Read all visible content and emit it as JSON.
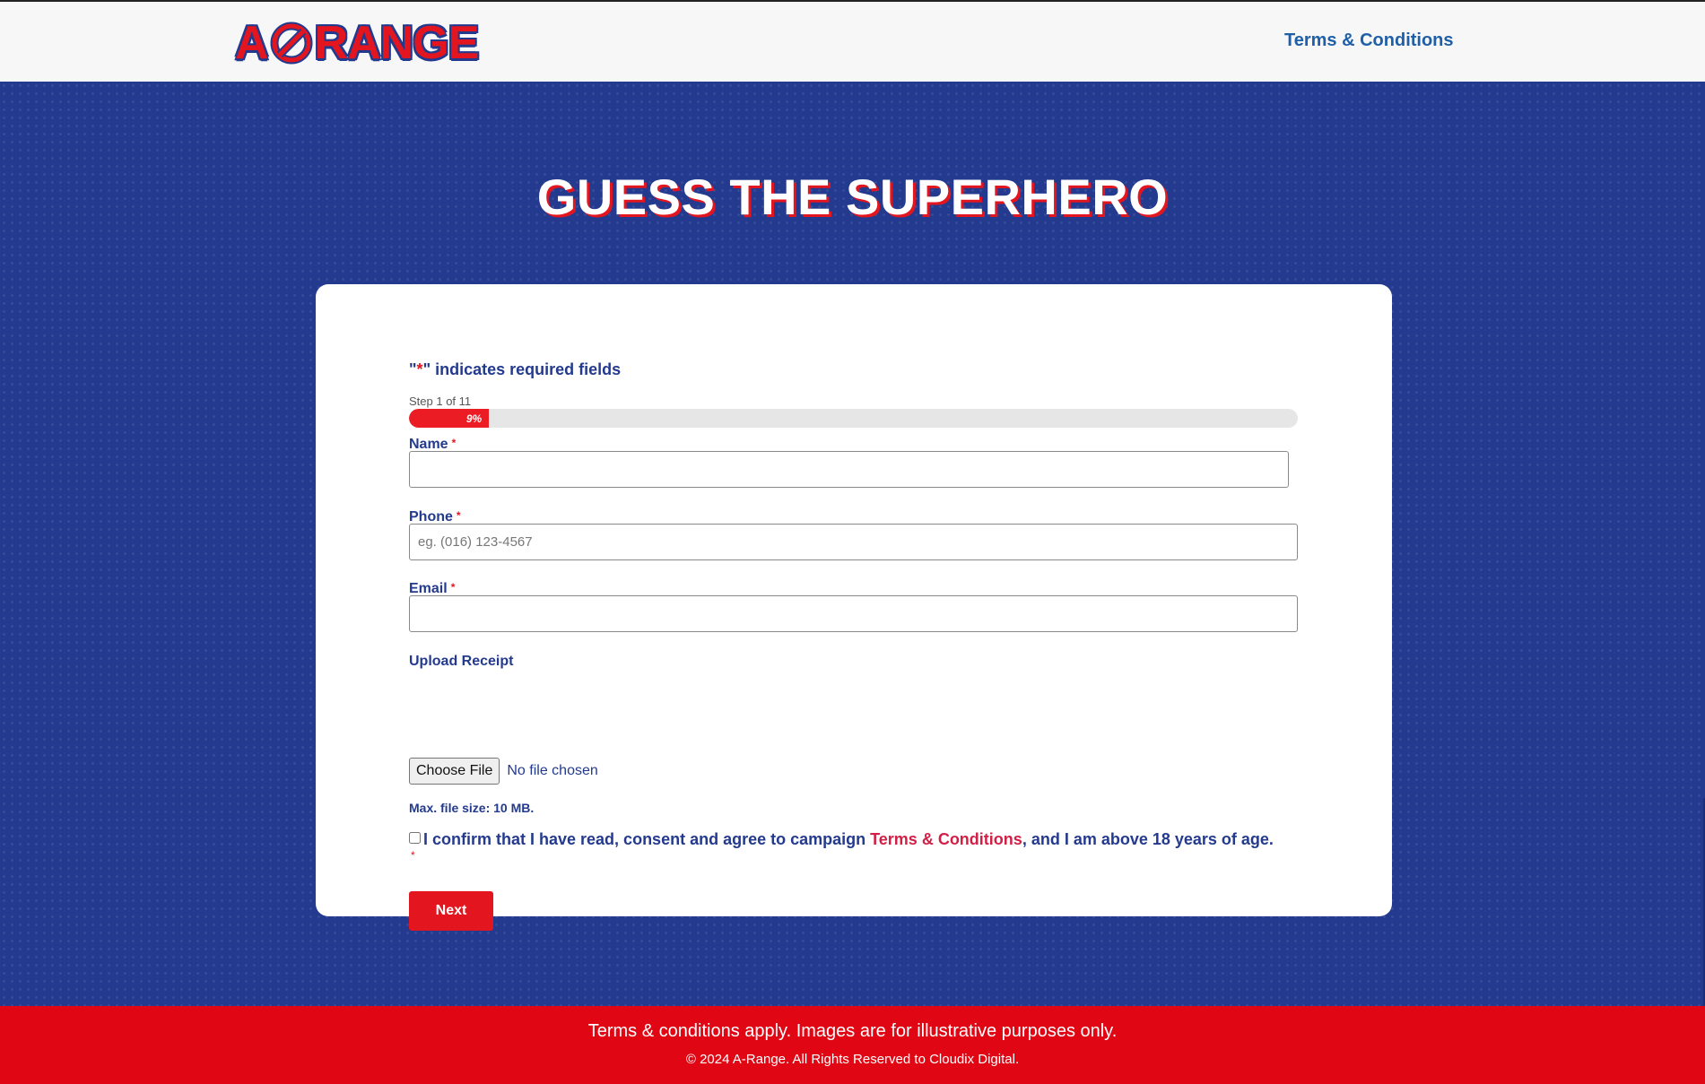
{
  "header": {
    "logo_text_left": "A",
    "logo_text_right": "RANGE",
    "nav_terms": "Terms & Conditions"
  },
  "hero": {
    "title": "GUESS THE SUPERHERO"
  },
  "form": {
    "required_note_open": "\"",
    "required_note_star": "*",
    "required_note_rest": "\" indicates required fields",
    "step_label": "Step 1 of 11",
    "progress_percent": 9,
    "progress_label": "9%",
    "required_marker": "*",
    "name_label": "Name",
    "name_value": "",
    "phone_label": "Phone",
    "phone_placeholder": "eg. (016) 123-4567",
    "email_label": "Email",
    "email_value": "",
    "upload_label": "Upload Receipt",
    "choose_file": "Choose File",
    "no_file": "No file chosen",
    "max_file": "Max. file size: 10 MB.",
    "consent_before": "I confirm that I have read, consent and agree to campaign ",
    "consent_link": "Terms & Conditions",
    "consent_after": ", and I am above 18 years of age.",
    "next": "Next"
  },
  "footer": {
    "line1": "Terms & conditions apply. Images are for illustrative purposes only.",
    "line2": "© 2024 A-Range. All Rights Reserved to Cloudix Digital."
  },
  "colors": {
    "brand_blue": "#233a8e",
    "brand_red": "#e3151f",
    "link_blue": "#1f5fa8"
  }
}
